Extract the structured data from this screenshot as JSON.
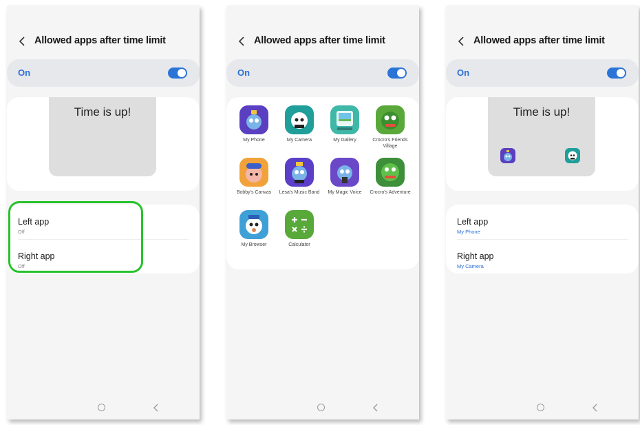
{
  "screens": [
    {
      "title": "Allowed apps after time limit",
      "on_label": "On",
      "preview_text": "Time is up!",
      "left_app": {
        "title": "Left app",
        "value": "Off"
      },
      "right_app": {
        "title": "Right app",
        "value": "Off"
      }
    },
    {
      "title": "Allowed apps after time limit",
      "on_label": "On",
      "apps": [
        {
          "label": "My Phone",
          "icon": "my-phone-icon",
          "color": "#5a3fc0"
        },
        {
          "label": "My Camera",
          "icon": "my-camera-icon",
          "color": "#1f9e9a"
        },
        {
          "label": "My Gallery",
          "icon": "my-gallery-icon",
          "color": "#3fb8a8"
        },
        {
          "label": "Crocro's Friends Village",
          "icon": "crocro-friends-village-icon",
          "color": "#5aa83a"
        },
        {
          "label": "Bobby's Canvas",
          "icon": "bobbys-canvas-icon",
          "color": "#f2a23a"
        },
        {
          "label": "Lesa's Music Band",
          "icon": "lesas-music-band-icon",
          "color": "#5b3fc8"
        },
        {
          "label": "My Magic Voice",
          "icon": "my-magic-voice-icon",
          "color": "#6a48c8"
        },
        {
          "label": "Crocro's Adventure",
          "icon": "crocros-adventure-icon",
          "color": "#3d8f3a"
        },
        {
          "label": "My Browser",
          "icon": "my-browser-icon",
          "color": "#3fa0d8"
        },
        {
          "label": "Calculator",
          "icon": "calculator-icon",
          "color": "#58a83a"
        }
      ]
    },
    {
      "title": "Allowed apps after time limit",
      "on_label": "On",
      "preview_text": "Time is up!",
      "left_app": {
        "title": "Left app",
        "value": "My Phone"
      },
      "right_app": {
        "title": "Right app",
        "value": "My Camera"
      }
    }
  ],
  "colors": {
    "accent": "#2a74d8",
    "highlight": "#27c22b",
    "background": "#f5f5f5"
  }
}
